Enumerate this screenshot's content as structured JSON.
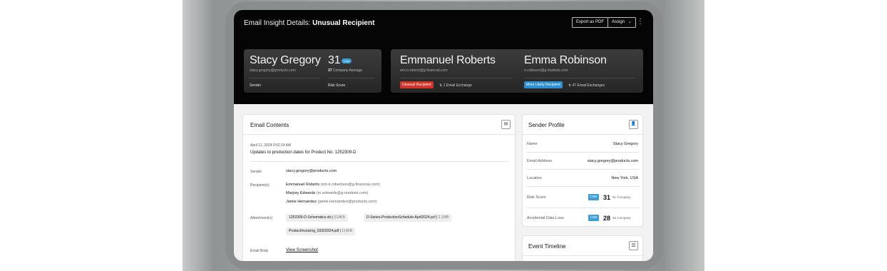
{
  "header": {
    "title_prefix": "Email Insight Details:",
    "title_strong": "Unusual Recipient",
    "export_label": "Export as PDF",
    "assign_label": "Assign",
    "assign_chevron": "⌄",
    "more_icon": "⋮"
  },
  "sender_card": {
    "name": "Stacy Gregory",
    "email": "stacy.gregory@products.com",
    "role": "Sender",
    "risk_value": "31",
    "risk_badge": "Low",
    "company_avg_value": "37",
    "company_avg_label": "Company Average",
    "risk_label": "Risk Score"
  },
  "recipient_card": {
    "r1_name": "Emmanuel Roberts",
    "r1_email": "em.k.roberts@g-financial.com",
    "r1_status": "Unusual Recipient",
    "r1_exchange": "1 Email Exchange",
    "r2_name": "Emma Robinson",
    "r2_email": "e.robinson@g-markets.com",
    "r2_status": "More Likely Recipient",
    "r2_exchange": "47 Email Exchanges",
    "exchange_icon": "⇅"
  },
  "email_contents": {
    "title": "Email Contents",
    "icon": "✉",
    "date": "April 11, 2024 9:52:14 AM",
    "subject": "Updates to production dates for Product No. 1252309-D",
    "sender_label": "Sender",
    "sender_value": "stacy.gregory@products.com",
    "recipients_label": "Recipient(s)",
    "recipients": [
      {
        "name": "Emmanuel Roberts",
        "email": "(em.k.robertson@g-financial.com)"
      },
      {
        "name": "Marjory Edwards",
        "email": "(m.edwards@g-markets.com)"
      },
      {
        "name": "Jamie Hernandez",
        "email": "(jamie.hernandez@products.com)"
      }
    ],
    "attachments_label": "Attachment(s)",
    "attachments": [
      {
        "name": "1252309-D-Schematics.xls",
        "size": "514KB"
      },
      {
        "name": "D-Series-ProductionSchedule-April2024.pcf",
        "size": "2.1MB"
      },
      {
        "name": "ProductInvoicing_03302024.pdf",
        "size": "114KB"
      }
    ],
    "body_label": "Email Body",
    "body_link": "View Screenshot"
  },
  "sender_profile": {
    "title": "Sender Profile",
    "icon": "👤",
    "name_label": "Name",
    "name_value": "Stacy Gregory",
    "email_label": "Email Address",
    "email_value": "stacy.gregory@products.com",
    "location_label": "Location",
    "location_value": "New York, USA",
    "risk_label": "Risk Score",
    "risk_badge": "Low",
    "risk_value": "31",
    "risk_company": "61 Company",
    "adl_label": "Accidental Data Loss",
    "adl_badge": "Low",
    "adl_value": "28",
    "adl_company": "36 Company"
  },
  "event_timeline": {
    "title": "Event Timeline",
    "icon": "☰"
  },
  "colors": {
    "unusual": "#d2342a",
    "likely": "#2e8fcf",
    "low": "#3d9fd6"
  }
}
